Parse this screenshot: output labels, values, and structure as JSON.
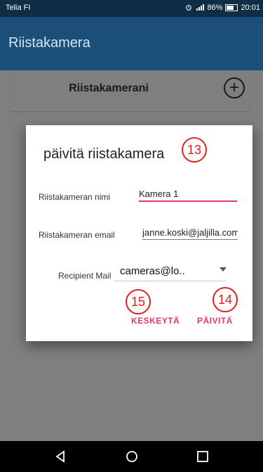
{
  "status_bar": {
    "carrier": "Telia FI",
    "battery": "86%",
    "time": "20:01"
  },
  "app_bar": {
    "title": "Riistakamera"
  },
  "background": {
    "card_title": "Riistakamerani",
    "add_icon": "plus-circle-icon"
  },
  "dialog": {
    "title": "päivitä riistakamera",
    "fields": {
      "name_label": "Riistakameran nimi",
      "name_value": "Kamera 1",
      "email_label": "Riistakameran email",
      "email_value": "janne.koski@jaljilla.com",
      "recipient_label": "Recipient Mail",
      "recipient_value": "cameras@lo.."
    },
    "buttons": {
      "cancel": "KESKEYTÄ",
      "update": "PÄIVITÄ"
    },
    "annotations": {
      "badge_title": "13",
      "badge_update": "14",
      "badge_cancel": "15"
    }
  },
  "nav": {
    "back_icon": "back-icon",
    "home_icon": "home-icon",
    "recent_icon": "recent-apps-icon"
  },
  "colors": {
    "status_bar": "#0f2d45",
    "app_bar": "#1b4f79",
    "accent": "#e03a6b",
    "annotation": "#e02020"
  }
}
